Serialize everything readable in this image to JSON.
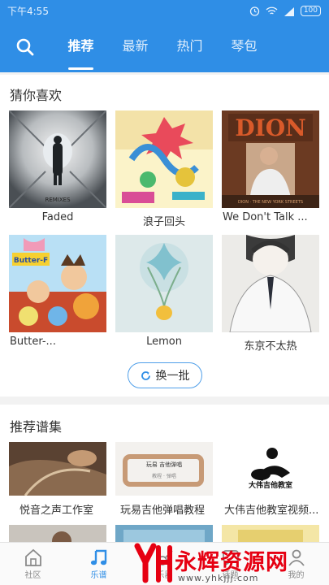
{
  "status_bar": {
    "time": "下午4:55",
    "battery": "100"
  },
  "header": {
    "tabs": [
      {
        "label": "推荐",
        "active": true
      },
      {
        "label": "最新",
        "active": false
      },
      {
        "label": "热门",
        "active": false
      },
      {
        "label": "琴包",
        "active": false
      }
    ]
  },
  "guess": {
    "title": "猜你喜欢",
    "items": [
      {
        "label": "Faded"
      },
      {
        "label": "浪子回头"
      },
      {
        "label": "We Don't Talk ..."
      },
      {
        "label": "Butter-..."
      },
      {
        "label": "Lemon"
      },
      {
        "label": "东京不太热"
      }
    ],
    "refresh_label": "换一批"
  },
  "collections": {
    "title": "推荐谱集",
    "items": [
      {
        "label": "悦音之声工作室"
      },
      {
        "label": "玩易吉他弹唱教程"
      },
      {
        "label": "大伟吉他教室视频..."
      }
    ]
  },
  "bottom_nav": {
    "items": [
      {
        "label": "社区",
        "active": false
      },
      {
        "label": "乐谱",
        "active": true
      },
      {
        "label": "乐器",
        "active": false
      },
      {
        "label": "话题",
        "active": false
      },
      {
        "label": "我的",
        "active": false
      }
    ]
  },
  "watermark": {
    "text": "永辉资源网",
    "url": "www.yhkjjj.com"
  },
  "colors": {
    "primary": "#2f8ee6",
    "watermark_red": "#e60012"
  }
}
